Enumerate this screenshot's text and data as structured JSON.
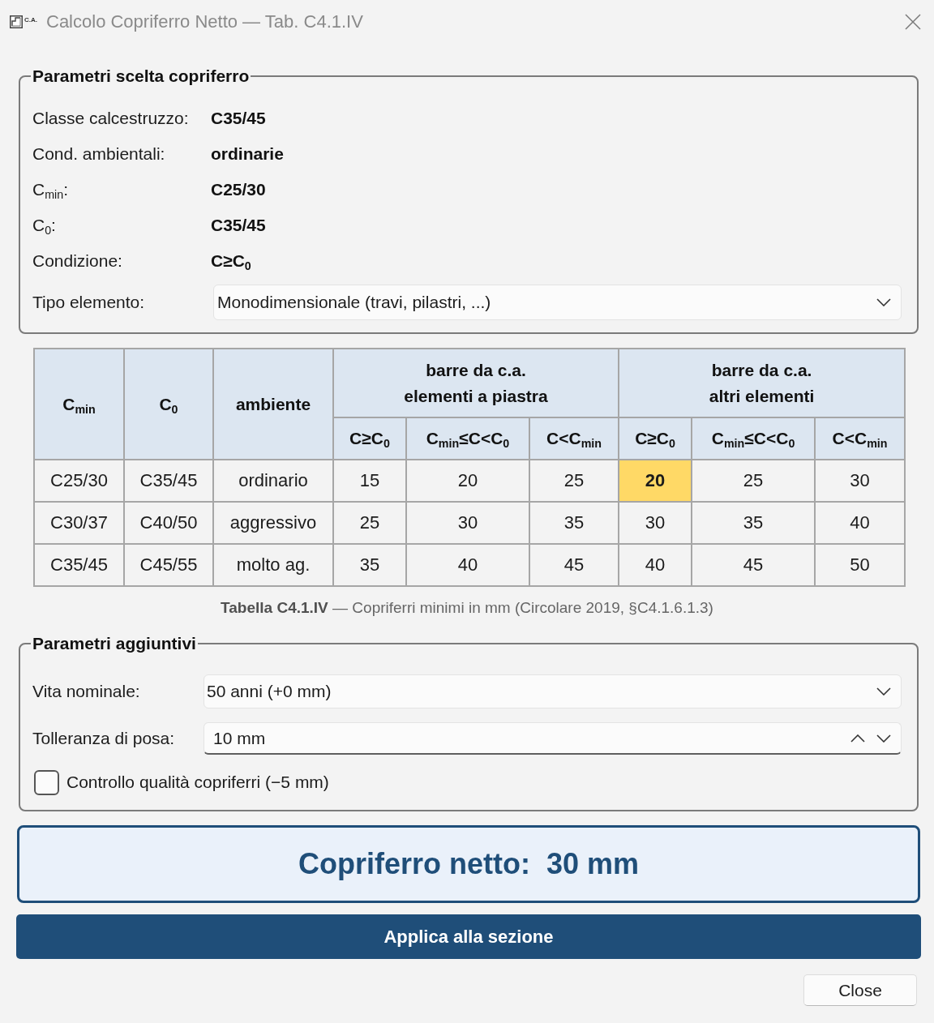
{
  "window": {
    "title": "Calcolo Copriferro Netto — Tab. C4.1.IV",
    "logo_text": "C.A."
  },
  "params": {
    "title": "Parametri scelta copriferro",
    "rows": [
      {
        "label": "Classe calcestruzzo:",
        "value": "C35/45"
      },
      {
        "label": "Cond. ambientali:",
        "value": "ordinarie"
      },
      {
        "label": "C$_{min}$:",
        "value": "C25/30"
      },
      {
        "label": "C$_{0}$:",
        "value": "C35/45"
      },
      {
        "label": "Condizione:",
        "value": "C≥C$_{0}$"
      }
    ],
    "element_type": {
      "label": "Tipo elemento:",
      "value": "Monodimensionale (travi, pilastri, ...)"
    }
  },
  "table": {
    "columns": [
      "C$_{min}$",
      "C$_{0}$",
      "ambiente"
    ],
    "groups": [
      {
        "title": "barre da c.a.\nelementi a piastra",
        "columns": [
          "C≥C$_{0}$",
          "C$_{min}$≤C<C$_{0}$",
          "C<C$_{min}$"
        ]
      },
      {
        "title": "barre da c.a.\naltri elementi",
        "columns": [
          "C≥C$_{0}$",
          "C$_{min}$≤C<C$_{0}$",
          "C<C$_{min}$"
        ]
      }
    ],
    "rows": [
      {
        "cells": [
          "C25/30",
          "C35/45",
          "ordinario"
        ],
        "values": [
          {
            "text": "15",
            "selected": false
          },
          {
            "text": "20",
            "selected": false
          },
          {
            "text": "25",
            "selected": false
          },
          {
            "text": "20",
            "selected": true
          },
          {
            "text": "25",
            "selected": false
          },
          {
            "text": "30",
            "selected": false
          }
        ]
      },
      {
        "cells": [
          "C30/37",
          "C40/50",
          "aggressivo"
        ],
        "values": [
          {
            "text": "25",
            "selected": false
          },
          {
            "text": "30",
            "selected": false
          },
          {
            "text": "35",
            "selected": false
          },
          {
            "text": "30",
            "selected": false
          },
          {
            "text": "35",
            "selected": false
          },
          {
            "text": "40",
            "selected": false
          }
        ]
      },
      {
        "cells": [
          "C35/45",
          "C45/55",
          "molto ag."
        ],
        "values": [
          {
            "text": "35",
            "selected": false
          },
          {
            "text": "40",
            "selected": false
          },
          {
            "text": "45",
            "selected": false
          },
          {
            "text": "40",
            "selected": false
          },
          {
            "text": "45",
            "selected": false
          },
          {
            "text": "50",
            "selected": false
          }
        ]
      }
    ],
    "caption": "**Tabella C4.1.IV** — Copriferri minimi in mm (Circolare 2019, §C4.1.6.1.3)"
  },
  "extra": {
    "title": "Parametri aggiuntivi",
    "service_life": {
      "label": "Vita nominale:",
      "value": "50 anni (+0 mm)"
    },
    "tolerance": {
      "label": "Tolleranza di posa:",
      "value": "10 mm"
    },
    "quality_check": {
      "label": "Controllo qualità copriferri (−5 mm)",
      "checked": false
    }
  },
  "result": {
    "text": "Copriferro netto:  30 mm"
  },
  "buttons": {
    "apply": "Applica alla sezione",
    "close": "Close"
  }
}
